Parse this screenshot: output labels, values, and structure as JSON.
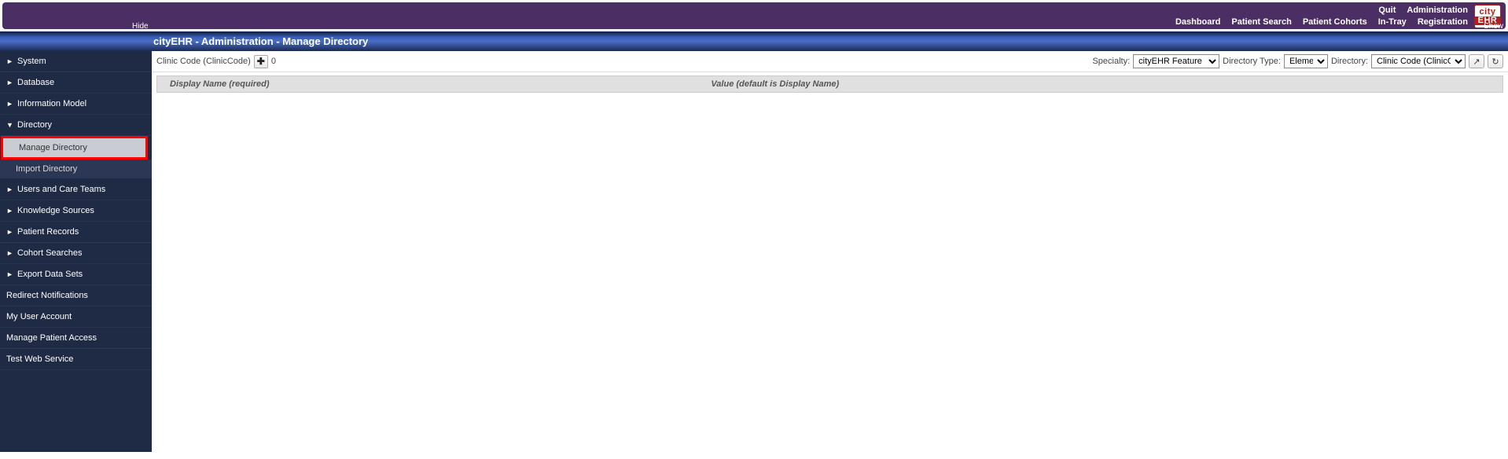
{
  "topbar": {
    "row1": {
      "quit": "Quit",
      "administration": "Administration"
    },
    "row2": {
      "dashboard": "Dashboard",
      "patient_search": "Patient Search",
      "patient_cohorts": "Patient Cohorts",
      "in_tray": "In-Tray",
      "registration": "Registration"
    }
  },
  "logo": {
    "top": "city",
    "bottom": "EHR"
  },
  "bluebar": {
    "hide": "Hide",
    "show": "Show",
    "title": "cityEHR - Administration - Manage Directory"
  },
  "sidebar": {
    "items": [
      {
        "label": "System",
        "expanded": false,
        "hasChildren": true
      },
      {
        "label": "Database",
        "expanded": false,
        "hasChildren": true
      },
      {
        "label": "Information Model",
        "expanded": false,
        "hasChildren": true
      },
      {
        "label": "Directory",
        "expanded": true,
        "hasChildren": true,
        "children": [
          {
            "label": "Manage Directory",
            "highlighted": true
          },
          {
            "label": "Import Directory",
            "highlighted": false
          }
        ]
      },
      {
        "label": "Users and Care Teams",
        "expanded": false,
        "hasChildren": true
      },
      {
        "label": "Knowledge Sources",
        "expanded": false,
        "hasChildren": true
      },
      {
        "label": "Patient Records",
        "expanded": false,
        "hasChildren": true
      },
      {
        "label": "Cohort Searches",
        "expanded": false,
        "hasChildren": true
      },
      {
        "label": "Export Data Sets",
        "expanded": false,
        "hasChildren": true
      },
      {
        "label": "Redirect Notifications",
        "expanded": false,
        "hasChildren": false
      },
      {
        "label": "My User Account",
        "expanded": false,
        "hasChildren": false
      },
      {
        "label": "Manage Patient Access",
        "expanded": false,
        "hasChildren": false
      },
      {
        "label": "Test Web Service",
        "expanded": false,
        "hasChildren": false
      }
    ]
  },
  "toolbar": {
    "clinic_code_label": "Clinic Code (ClinicCode)",
    "add": "✚",
    "count": "0",
    "specialty_label": "Specialty:",
    "specialty_value": "cityEHR Feature Demo",
    "directory_type_label": "Directory Type:",
    "directory_type_value": "Element",
    "directory_label": "Directory:",
    "directory_value": "Clinic Code (ClinicCode)",
    "export_icon": "↗",
    "refresh_icon": "↻"
  },
  "table": {
    "header_display_name": "Display Name (required)",
    "header_value": "Value (default is Display Name)"
  }
}
